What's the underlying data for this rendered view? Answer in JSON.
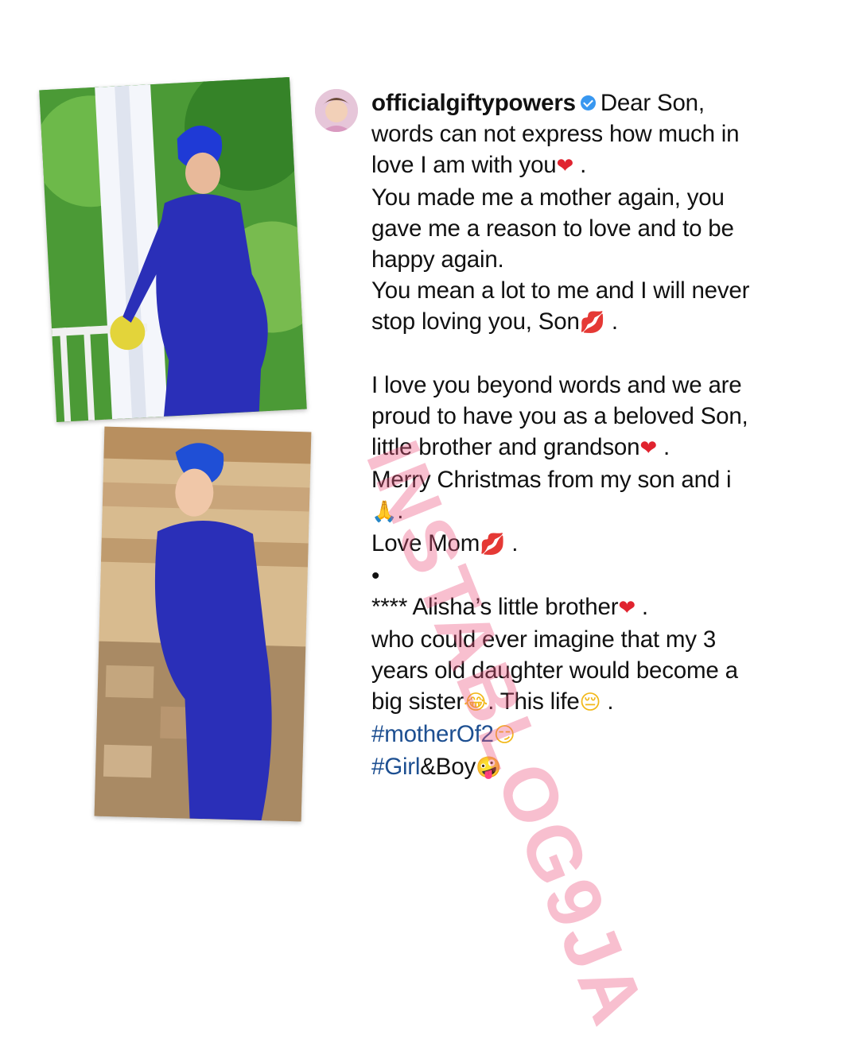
{
  "post": {
    "username": "officialgiftypowers",
    "verified": true,
    "avatar_icon": "profile-avatar",
    "caption_lines": [
      {
        "text": "Dear Son,",
        "type": "first"
      },
      {
        "text": "words can not express how much in"
      },
      {
        "text": "love I am with you",
        "emoji": "❤",
        "emoji_class": "heart",
        "suffix": " ."
      },
      {
        "text": "You made me a mother again, you"
      },
      {
        "text": "gave me a reason to love and to be"
      },
      {
        "text": "happy again."
      },
      {
        "text": "You mean a lot to me and I will never"
      },
      {
        "text": "stop loving you, Son",
        "emoji": "💋",
        "emoji_class": "kiss",
        "suffix": " ."
      },
      {
        "text": "",
        "type": "blank"
      },
      {
        "text": "I love you beyond words and we are"
      },
      {
        "text": "proud to have you as a beloved Son,"
      },
      {
        "text": "little brother and grandson",
        "emoji": "❤",
        "emoji_class": "heart",
        "suffix": " ."
      },
      {
        "text": "Merry Christmas from my son and i"
      },
      {
        "text": "",
        "emoji": "🙏",
        "emoji_class": "pray",
        "suffix": "."
      },
      {
        "text": "Love Mom",
        "emoji": "💋",
        "emoji_class": "kiss",
        "suffix": " ."
      },
      {
        "text": "•"
      },
      {
        "text": "**** Alisha’s little brother",
        "emoji": "❤",
        "emoji_class": "heart",
        "suffix": " ."
      },
      {
        "text": "who could ever imagine that my 3"
      },
      {
        "text": "years old daughter would become a"
      },
      {
        "text": "big sister",
        "emoji": "😂",
        "emoji_class": "face",
        "suffix": ". This life",
        "emoji2": "😔",
        "suffix2": " ."
      },
      {
        "text": "#motherOf2",
        "type": "tag",
        "emoji": "😏",
        "emoji_class": "face"
      },
      {
        "text": "#Girl",
        "type": "tag",
        "plain": "&Boy",
        "emoji": "🤪",
        "emoji_class": "face"
      }
    ]
  },
  "watermark": {
    "text": "INSTABLOG9JA",
    "color": "#ec5882"
  },
  "photos": [
    {
      "name": "photo-top",
      "description_icon": "woman-in-blue-sequin-dress-on-porch-photo"
    },
    {
      "name": "photo-bottom",
      "description_icon": "woman-in-blue-sequin-dress-seated-photo"
    }
  ],
  "colors": {
    "hashtag": "#1d4f91",
    "verified_badge": "#3897f0",
    "dress": "#2a2fb8"
  }
}
